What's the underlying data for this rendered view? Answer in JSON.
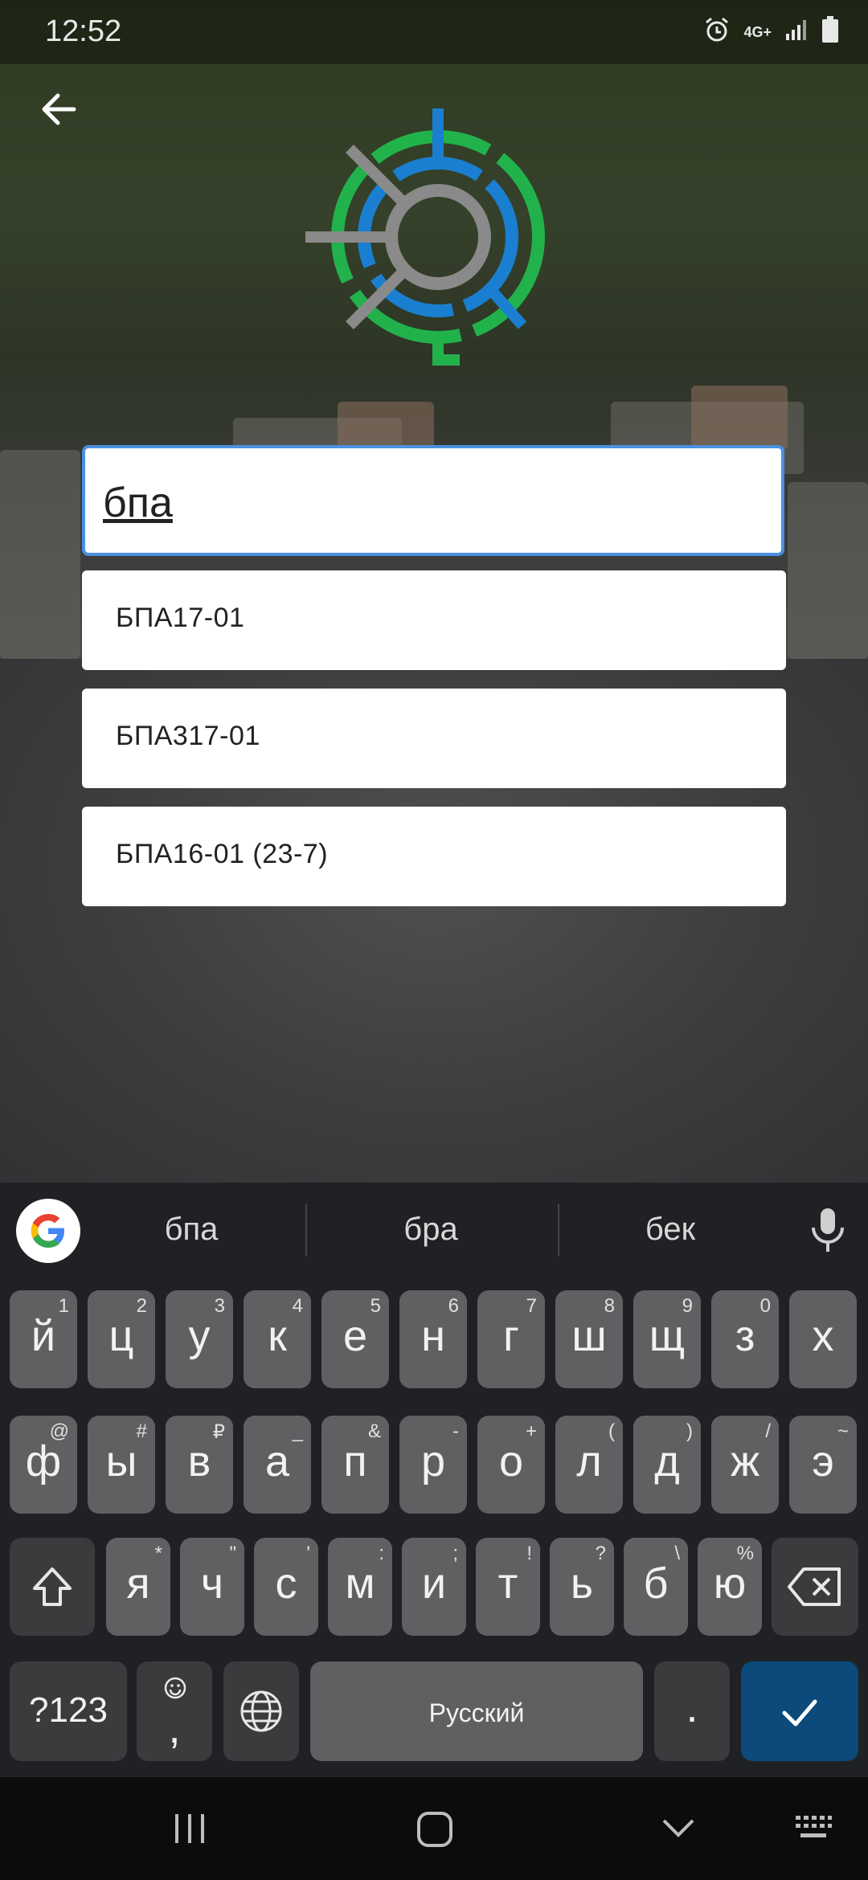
{
  "status": {
    "time": "12:52",
    "network": "4G+",
    "icons": [
      "alarm-icon",
      "signal-icon",
      "battery-icon"
    ]
  },
  "search": {
    "value": "бпа"
  },
  "suggestions": [
    "БПА17-01",
    "БПА317-01",
    "БПА16-01 (23-7)"
  ],
  "keyboard": {
    "suggestions": [
      "бпа",
      "бра",
      "бек"
    ],
    "row1": [
      [
        "й",
        "1"
      ],
      [
        "ц",
        "2"
      ],
      [
        "у",
        "3"
      ],
      [
        "к",
        "4"
      ],
      [
        "е",
        "5"
      ],
      [
        "н",
        "6"
      ],
      [
        "г",
        "7"
      ],
      [
        "ш",
        "8"
      ],
      [
        "щ",
        "9"
      ],
      [
        "з",
        "0"
      ],
      [
        "х",
        ""
      ]
    ],
    "row2": [
      [
        "ф",
        "@"
      ],
      [
        "ы",
        "#"
      ],
      [
        "в",
        "₽"
      ],
      [
        "а",
        "_"
      ],
      [
        "п",
        "&"
      ],
      [
        "р",
        "-"
      ],
      [
        "о",
        "+"
      ],
      [
        "л",
        "("
      ],
      [
        "д",
        ")"
      ],
      [
        "ж",
        "/"
      ],
      [
        "э",
        "~"
      ]
    ],
    "row3": [
      [
        "я",
        "*"
      ],
      [
        "ч",
        "\""
      ],
      [
        "с",
        "'"
      ],
      [
        "м",
        ":"
      ],
      [
        "и",
        ";"
      ],
      [
        "т",
        "!"
      ],
      [
        "ь",
        "?"
      ],
      [
        "б",
        "\\"
      ],
      [
        "ю",
        "%"
      ]
    ],
    "symbols_label": "?123",
    "comma": ",",
    "space_label": "Русский",
    "period": "."
  },
  "colors": {
    "accent": "#4a90e2",
    "logo_green": "#22b24c",
    "logo_blue": "#1a7fd0",
    "logo_gray": "#8a8a8a",
    "enter_key": "#0b4a7a"
  }
}
